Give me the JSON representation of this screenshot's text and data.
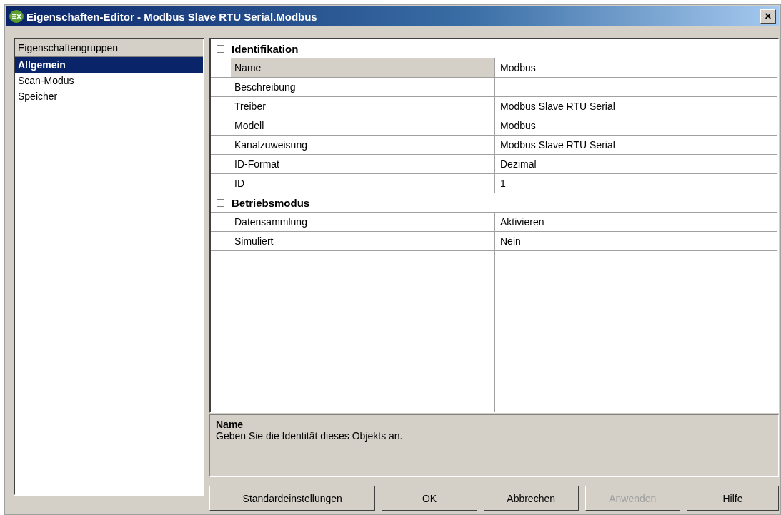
{
  "window": {
    "title": "Eigenschaften-Editor - Modbus Slave RTU Serial.Modbus",
    "close": "×"
  },
  "groups": {
    "header": "Eigenschaftengruppen",
    "items": [
      {
        "label": "Allgemein",
        "selected": true
      },
      {
        "label": "Scan-Modus",
        "selected": false
      },
      {
        "label": "Speicher",
        "selected": false
      }
    ]
  },
  "sections": [
    {
      "title": "Identifikation",
      "expanded": true,
      "properties": [
        {
          "name": "Name",
          "value": "Modbus",
          "selected": true
        },
        {
          "name": "Beschreibung",
          "selected": false
        },
        {
          "name": "Treiber",
          "value": "Modbus Slave RTU Serial",
          "selected": false
        },
        {
          "name": "Modell",
          "value": "Modbus",
          "selected": false
        },
        {
          "name": "Kanalzuweisung",
          "value": "Modbus Slave RTU Serial",
          "selected": false
        },
        {
          "name": "ID-Format",
          "value": "Dezimal",
          "selected": false
        },
        {
          "name": "ID",
          "value": "1",
          "selected": false
        }
      ]
    },
    {
      "title": "Betriebsmodus",
      "expanded": true,
      "properties": [
        {
          "name": "Datensammlung",
          "value": "Aktivieren",
          "selected": false
        },
        {
          "name": "Simuliert",
          "value": "Nein",
          "selected": false
        }
      ]
    }
  ],
  "description": {
    "title": "Name",
    "text": "Geben Sie die Identität dieses Objekts an."
  },
  "buttons": [
    {
      "label": "Standardeinstellungen",
      "disabled": false
    },
    {
      "label": "OK",
      "disabled": false
    },
    {
      "label": "Abbrechen",
      "disabled": false
    },
    {
      "label": "Anwenden",
      "disabled": true
    },
    {
      "label": "Hilfe",
      "disabled": false
    }
  ]
}
